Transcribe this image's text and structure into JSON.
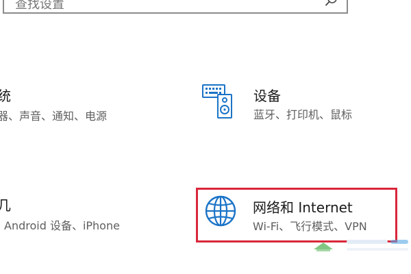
{
  "search": {
    "placeholder": "查找设置"
  },
  "tiles": {
    "system": {
      "title": "统",
      "description": "器、声音、通知、电源"
    },
    "devices": {
      "title": "设备",
      "description": "蓝牙、打印机、鼠标",
      "icon": "keyboard-speaker-icon"
    },
    "phone": {
      "title": "几",
      "description": "Android 设备、iPhone"
    },
    "network": {
      "title": "网络和 Internet",
      "description": "Wi-Fi、飞行模式、VPN",
      "icon": "globe-icon"
    }
  },
  "colors": {
    "accent": "#1a73c7",
    "highlight_border": "#d9263a",
    "description_text": "#5e5e5e"
  }
}
